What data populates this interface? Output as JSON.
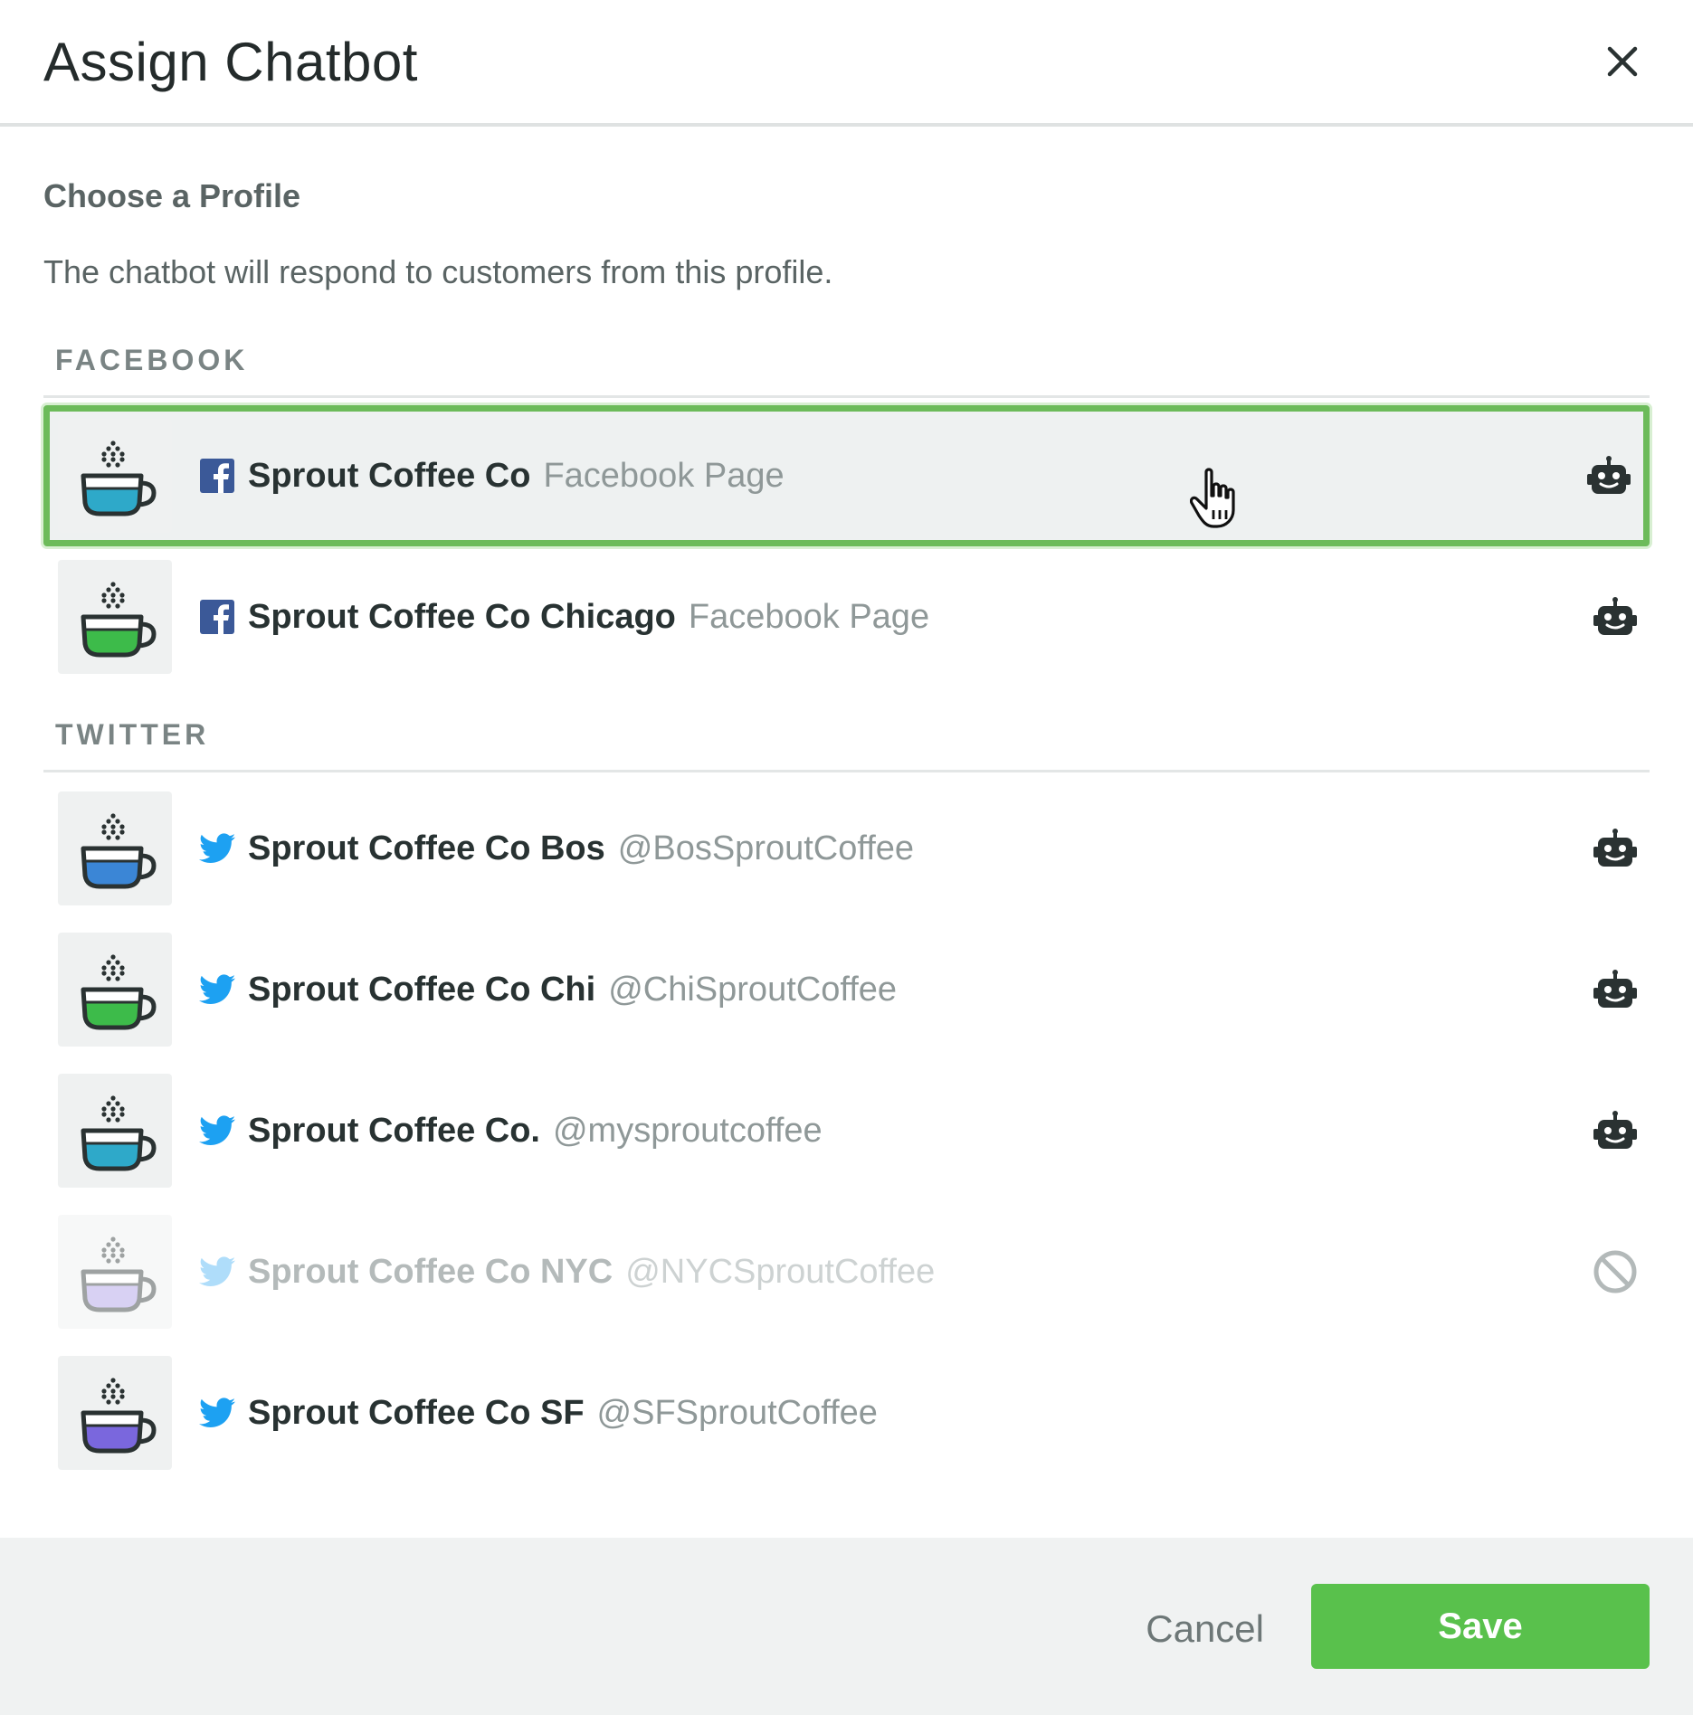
{
  "dialog": {
    "title": "Assign Chatbot",
    "close_icon": "close-icon",
    "subtitle": "Choose a Profile",
    "description": "The chatbot will respond to customers from this profile."
  },
  "sections": {
    "facebook": {
      "label": "FACEBOOK",
      "profiles": [
        {
          "name": "Sprout Coffee Co",
          "handle": "Facebook Page",
          "network_icon": "facebook-icon",
          "status_icon": "chatbot-icon",
          "selected": true,
          "cup_color": "#2ea9c9"
        },
        {
          "name": "Sprout Coffee Co Chicago",
          "handle": "Facebook Page",
          "network_icon": "facebook-icon",
          "status_icon": "chatbot-icon",
          "selected": false,
          "cup_color": "#3dbb4a"
        }
      ]
    },
    "twitter": {
      "label": "TWITTER",
      "profiles": [
        {
          "name": "Sprout Coffee Co Bos",
          "handle": "@BosSproutCoffee",
          "network_icon": "twitter-icon",
          "status_icon": "chatbot-icon",
          "disabled": false,
          "cup_color": "#3b86d6"
        },
        {
          "name": "Sprout Coffee Co Chi",
          "handle": "@ChiSproutCoffee",
          "network_icon": "twitter-icon",
          "status_icon": "chatbot-icon",
          "disabled": false,
          "cup_color": "#3dbb4a"
        },
        {
          "name": "Sprout Coffee Co.",
          "handle": "@mysproutcoffee",
          "network_icon": "twitter-icon",
          "status_icon": "chatbot-icon",
          "disabled": false,
          "cup_color": "#2ea9c9"
        },
        {
          "name": "Sprout Coffee Co NYC",
          "handle": "@NYCSproutCoffee",
          "network_icon": "twitter-icon",
          "status_icon": "prohibited-icon",
          "disabled": true,
          "cup_color": "#a99be6"
        },
        {
          "name": "Sprout Coffee Co SF",
          "handle": "@SFSproutCoffee",
          "network_icon": "twitter-icon",
          "status_icon": "",
          "disabled": false,
          "cup_color": "#7a67dd"
        }
      ]
    }
  },
  "footer": {
    "cancel_label": "Cancel",
    "save_label": "Save"
  },
  "colors": {
    "accent_green": "#59c14c",
    "selected_border": "#6cbb5a",
    "facebook_blue": "#3b5998",
    "twitter_blue": "#1da1f2"
  }
}
